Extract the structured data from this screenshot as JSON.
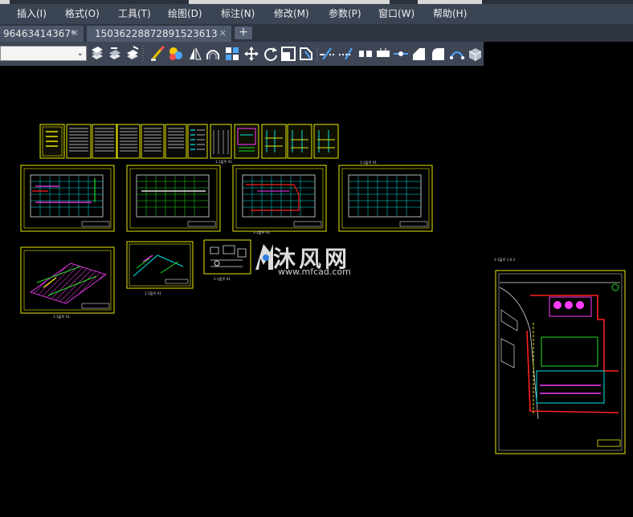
{
  "menu": {
    "items": [
      {
        "label": "插入(I)"
      },
      {
        "label": "格式(O)"
      },
      {
        "label": "工具(T)"
      },
      {
        "label": "绘图(D)"
      },
      {
        "label": "标注(N)"
      },
      {
        "label": "修改(M)"
      },
      {
        "label": "参数(P)"
      },
      {
        "label": "窗口(W)"
      },
      {
        "label": "帮助(H)"
      }
    ]
  },
  "tabs": [
    {
      "label": "96463414367*",
      "close": "✕"
    },
    {
      "label": "15036228872891523613",
      "close": "✕"
    }
  ],
  "tab_add": "+",
  "toolbar": {
    "combo_value": "",
    "combo_arrow": "⌄",
    "icons": [
      "layer-state-icon",
      "layer-match-icon",
      "layer-previous-icon",
      "match-properties-icon",
      "color-wheel-icon",
      "mirror-icon",
      "offset-icon",
      "array-icon",
      "move-icon",
      "rotate-icon",
      "scale-icon",
      "stretch-icon",
      "trim-icon",
      "extend-icon",
      "break-icon",
      "join-icon",
      "break-at-point-icon",
      "chamfer-icon",
      "fillet-icon",
      "blend-icon",
      "explode-icon"
    ]
  },
  "drawing": {
    "captions": {
      "plan1": "1-1层平 A1",
      "plan3": "1-1层平 A1",
      "plan4": "1-1层平 A1",
      "axo": "1-1层平 A1",
      "detail1": "1-1层平 A1",
      "detail2": "1-1层平 A1",
      "site": "1-1层平 1:0.3"
    }
  },
  "watermark": {
    "text": "沐风网",
    "url": "www.mfcad.com"
  },
  "colors": {
    "menubar": "#3b4453",
    "tabbar": "#2e3440",
    "toolbar": "#3e4656",
    "canvas": "#000000",
    "sheet_border": "#e8e800",
    "cyan": "#00e5e5",
    "magenta": "#ff3cff",
    "red": "#ff2020",
    "green": "#20e020"
  }
}
